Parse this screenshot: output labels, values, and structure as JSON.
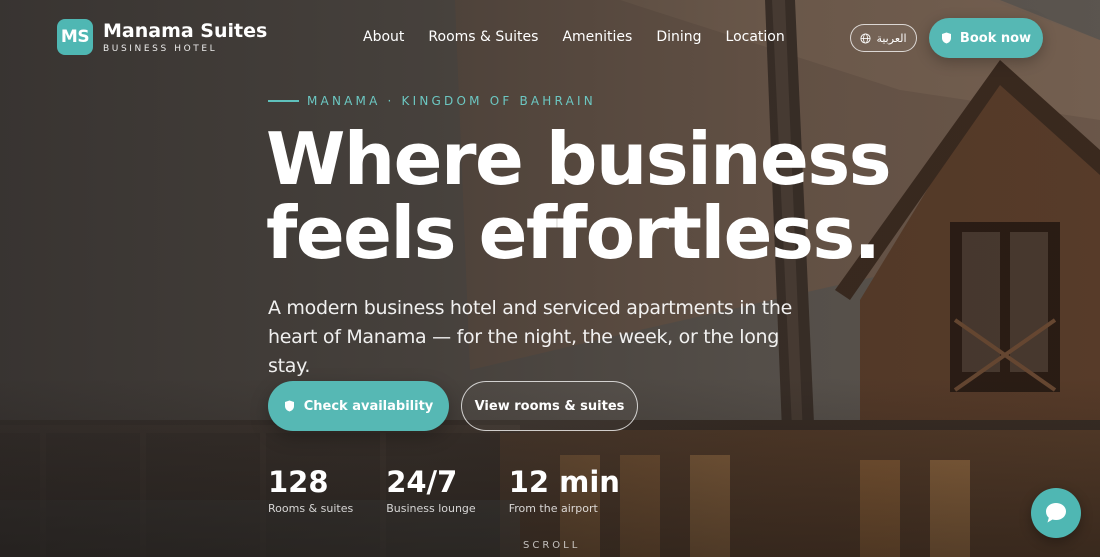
{
  "brand": {
    "logo_initials": "MS",
    "name": "Manama Suites",
    "tagline": "BUSINESS HOTEL",
    "accent_color": "#56b8b4"
  },
  "nav": {
    "items": [
      {
        "label": "About"
      },
      {
        "label": "Rooms & Suites"
      },
      {
        "label": "Amenities"
      },
      {
        "label": "Dining"
      },
      {
        "label": "Location"
      }
    ]
  },
  "header_actions": {
    "language_label": "العربية",
    "language_icon": "globe-icon",
    "book_label": "Book now",
    "book_icon": "shield-icon"
  },
  "hero": {
    "eyebrow": "MANAMA · KINGDOM OF BAHRAIN",
    "headline_line1": "Where business",
    "headline_line2": "feels effortless.",
    "subtitle": "A modern business hotel and serviced apartments in the heart of Manama — for the night, the week, or the long stay.",
    "primary_cta": "Check availability",
    "secondary_cta": "View rooms & suites"
  },
  "stats": [
    {
      "value": "128",
      "label": "Rooms & suites"
    },
    {
      "value": "24/7",
      "label": "Business lounge"
    },
    {
      "value": "12 min",
      "label": "From the airport"
    }
  ],
  "scroll_hint": "SCROLL",
  "chat": {
    "icon": "chat-bubble-icon"
  }
}
